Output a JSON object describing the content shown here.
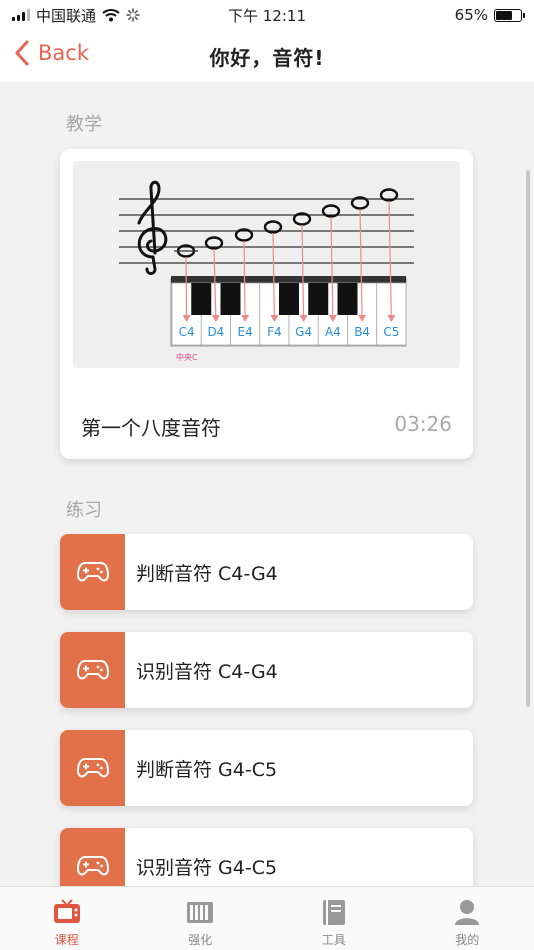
{
  "status_bar": {
    "carrier": "中国联通",
    "time": "下午 12:11",
    "battery_percent": "65%",
    "battery_level": 0.65
  },
  "nav": {
    "back_label": "Back",
    "title": "你好，音符!"
  },
  "teaching": {
    "section_title": "教学",
    "lesson": {
      "title": "第一个八度音符",
      "duration": "03:26",
      "illustration": {
        "middle_c_label": "中央C",
        "key_labels": [
          "C4",
          "D4",
          "E4",
          "F4",
          "G4",
          "A4",
          "B4",
          "C5"
        ]
      }
    }
  },
  "practice": {
    "section_title": "练习",
    "items": [
      {
        "label": "判断音符 C4-G4",
        "icon": "gamepad-icon"
      },
      {
        "label": "识别音符 C4-G4",
        "icon": "gamepad-icon"
      },
      {
        "label": "判断音符 G4-C5",
        "icon": "gamepad-icon"
      },
      {
        "label": "识别音符 G4-C5",
        "icon": "gamepad-icon"
      }
    ]
  },
  "tabbar": {
    "tabs": [
      {
        "label": "课程",
        "icon": "tv-icon",
        "active": true
      },
      {
        "label": "强化",
        "icon": "piano-icon",
        "active": false
      },
      {
        "label": "工具",
        "icon": "notebook-icon",
        "active": false
      },
      {
        "label": "我的",
        "icon": "person-icon",
        "active": false
      }
    ]
  },
  "colors": {
    "accent": "#e86452",
    "exercise_icon_bg": "#e2714a",
    "key_label": "#2a8fd8",
    "arrow": "#ee8a8a"
  }
}
